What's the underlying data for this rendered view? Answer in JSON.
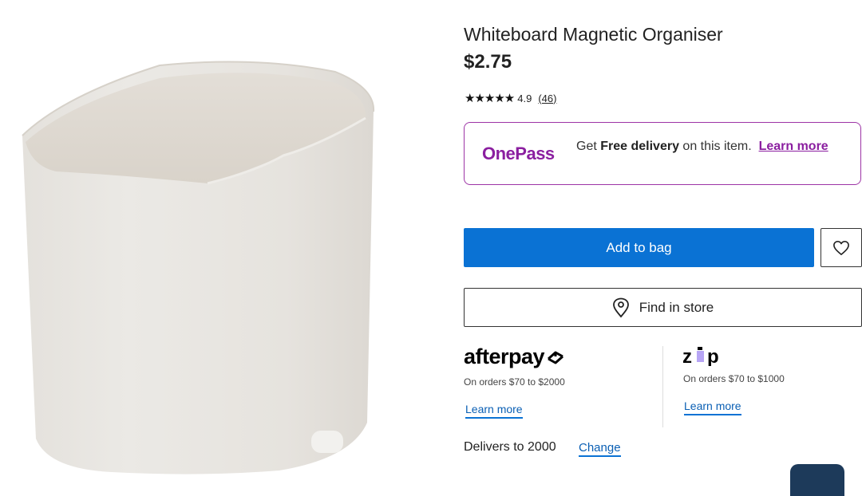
{
  "product": {
    "title": "Whiteboard Magnetic Organiser",
    "price": "$2.75",
    "rating": {
      "stars_value": 4.9,
      "stars_max": 5,
      "stars_display": "★★★★★",
      "score": "4.9",
      "count": "(46)"
    }
  },
  "onepass": {
    "logo": "OnePass",
    "text_before": "Get ",
    "text_bold": "Free delivery",
    "text_after": " on this item.",
    "link": "Learn more",
    "color": "#8b1fa0"
  },
  "actions": {
    "add_to_bag": "Add to bag",
    "wishlist_icon": "heart-icon",
    "find_in_store": "Find in store",
    "find_in_store_icon": "location-pin-icon",
    "primary_color": "#0a72d4"
  },
  "payments": {
    "afterpay": {
      "logo": "afterpay",
      "range": "On orders $70 to $2000",
      "link": "Learn more"
    },
    "zip": {
      "logo": "zip",
      "range": "On orders $70 to $1000",
      "link": "Learn more"
    }
  },
  "delivery": {
    "text": "Delivers to 2000",
    "change": "Change"
  }
}
